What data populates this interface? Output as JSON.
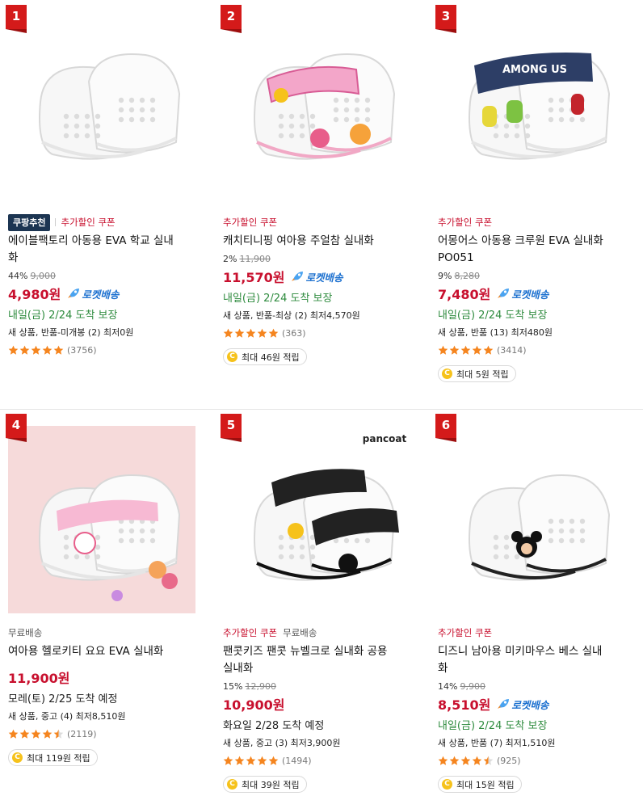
{
  "products": [
    {
      "rank": "1",
      "badges": [
        {
          "text": "쿠팡추천",
          "type": "pick"
        },
        {
          "text": "추가할인 쿠폰",
          "type": "red"
        }
      ],
      "title_lines": [
        "에이블팩토리 아동용 EVA 학교 실내",
        "화"
      ],
      "discount_rate": "44%",
      "original_price": "9,000",
      "price": "4,980원",
      "rocket": "로켓배송",
      "delivery": "내일(금) 2/24 도착 보장",
      "delivery_color": "green",
      "used_text": "새 상품, 반품-미개봉 (2) 최저0원",
      "rating": 5,
      "review_count": "(3756)",
      "reward": null,
      "image_theme": "plain"
    },
    {
      "rank": "2",
      "badges": [
        {
          "text": "추가할인 쿠폰",
          "type": "red"
        }
      ],
      "title_lines": [
        "캐치티니핑 여아용 주얼참 실내화"
      ],
      "discount_rate": "2%",
      "original_price": "11,900",
      "price": "11,570원",
      "rocket": "로켓배송",
      "delivery": "내일(금) 2/24 도착 보장",
      "delivery_color": "green",
      "used_text": "새 상품, 반품-최상 (2) 최저4,570원",
      "rating": 5,
      "review_count": "(363)",
      "reward": "최대 46원 적립",
      "image_theme": "pink"
    },
    {
      "rank": "3",
      "badges": [
        {
          "text": "추가할인 쿠폰",
          "type": "red"
        }
      ],
      "title_lines": [
        "어몽어스 아동용 크루원 EVA 실내화",
        "PO051"
      ],
      "discount_rate": "9%",
      "original_price": "8,280",
      "price": "7,480원",
      "rocket": "로켓배송",
      "delivery": "내일(금) 2/24 도착 보장",
      "delivery_color": "green",
      "used_text": "새 상품, 반품 (13) 최저480원",
      "rating": 5,
      "review_count": "(3414)",
      "reward": "최대 5원 적립",
      "image_theme": "navy",
      "image_text": "AMONG US"
    },
    {
      "rank": "4",
      "badges": [
        {
          "text": "무료배송",
          "type": "gray"
        }
      ],
      "title_lines": [
        "여아용 헬로키티 요요 EVA 실내화"
      ],
      "discount_rate": null,
      "original_price": null,
      "price": "11,900원",
      "rocket": null,
      "delivery": "모레(토) 2/25 도착 예정",
      "delivery_color": "dark",
      "used_text": "새 상품, 중고 (4) 최저8,510원",
      "rating": 4.5,
      "review_count": "(2119)",
      "reward": "최대 119원 적립",
      "image_theme": "kitty"
    },
    {
      "rank": "5",
      "badges": [
        {
          "text": "추가할인 쿠폰",
          "type": "red"
        },
        {
          "text": "무료배송",
          "type": "gray"
        }
      ],
      "title_lines": [
        "팬콧키즈 팬콧 뉴벨크로 실내화 공용",
        "실내화"
      ],
      "discount_rate": "15%",
      "original_price": "12,900",
      "price": "10,900원",
      "rocket": null,
      "delivery": "화요일 2/28 도착 예정",
      "delivery_color": "dark",
      "used_text": "새 상품, 중고 (3) 최저3,900원",
      "rating": 5,
      "review_count": "(1494)",
      "reward": "최대 39원 적립",
      "image_theme": "black",
      "image_text": "pancoat"
    },
    {
      "rank": "6",
      "badges": [
        {
          "text": "추가할인 쿠폰",
          "type": "red"
        }
      ],
      "title_lines": [
        "디즈니 남아용 미키마우스 베스 실내",
        "화"
      ],
      "discount_rate": "14%",
      "original_price": "9,900",
      "price": "8,510원",
      "rocket": "로켓배송",
      "delivery": "내일(금) 2/24 도착 보장",
      "delivery_color": "green",
      "used_text": "새 상품, 반품 (7) 최저1,510원",
      "rating": 4.5,
      "review_count": "(925)",
      "reward": "최대 15원 적립",
      "image_theme": "mickey"
    }
  ],
  "colors": {
    "price_red": "#c8102e",
    "rank_red": "#d41a1a",
    "delivery_green": "#2e8b3e",
    "rocket_blue": "#1a6fcf",
    "star_orange": "#f5851f",
    "coin_yellow": "#f6c21b"
  },
  "icons": {
    "rocket": "rocket-icon",
    "star": "star-icon",
    "coin": "coin-icon"
  }
}
